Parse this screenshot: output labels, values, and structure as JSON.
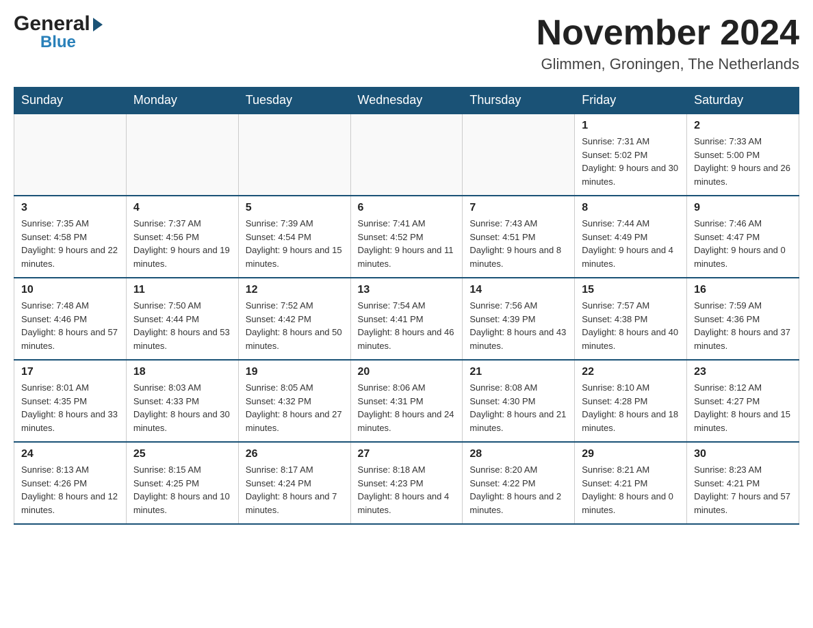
{
  "logo": {
    "line1": "General",
    "line2": "Blue"
  },
  "title": "November 2024",
  "location": "Glimmen, Groningen, The Netherlands",
  "days_of_week": [
    "Sunday",
    "Monday",
    "Tuesday",
    "Wednesday",
    "Thursday",
    "Friday",
    "Saturday"
  ],
  "weeks": [
    [
      {
        "day": "",
        "info": ""
      },
      {
        "day": "",
        "info": ""
      },
      {
        "day": "",
        "info": ""
      },
      {
        "day": "",
        "info": ""
      },
      {
        "day": "",
        "info": ""
      },
      {
        "day": "1",
        "info": "Sunrise: 7:31 AM\nSunset: 5:02 PM\nDaylight: 9 hours and 30 minutes."
      },
      {
        "day": "2",
        "info": "Sunrise: 7:33 AM\nSunset: 5:00 PM\nDaylight: 9 hours and 26 minutes."
      }
    ],
    [
      {
        "day": "3",
        "info": "Sunrise: 7:35 AM\nSunset: 4:58 PM\nDaylight: 9 hours and 22 minutes."
      },
      {
        "day": "4",
        "info": "Sunrise: 7:37 AM\nSunset: 4:56 PM\nDaylight: 9 hours and 19 minutes."
      },
      {
        "day": "5",
        "info": "Sunrise: 7:39 AM\nSunset: 4:54 PM\nDaylight: 9 hours and 15 minutes."
      },
      {
        "day": "6",
        "info": "Sunrise: 7:41 AM\nSunset: 4:52 PM\nDaylight: 9 hours and 11 minutes."
      },
      {
        "day": "7",
        "info": "Sunrise: 7:43 AM\nSunset: 4:51 PM\nDaylight: 9 hours and 8 minutes."
      },
      {
        "day": "8",
        "info": "Sunrise: 7:44 AM\nSunset: 4:49 PM\nDaylight: 9 hours and 4 minutes."
      },
      {
        "day": "9",
        "info": "Sunrise: 7:46 AM\nSunset: 4:47 PM\nDaylight: 9 hours and 0 minutes."
      }
    ],
    [
      {
        "day": "10",
        "info": "Sunrise: 7:48 AM\nSunset: 4:46 PM\nDaylight: 8 hours and 57 minutes."
      },
      {
        "day": "11",
        "info": "Sunrise: 7:50 AM\nSunset: 4:44 PM\nDaylight: 8 hours and 53 minutes."
      },
      {
        "day": "12",
        "info": "Sunrise: 7:52 AM\nSunset: 4:42 PM\nDaylight: 8 hours and 50 minutes."
      },
      {
        "day": "13",
        "info": "Sunrise: 7:54 AM\nSunset: 4:41 PM\nDaylight: 8 hours and 46 minutes."
      },
      {
        "day": "14",
        "info": "Sunrise: 7:56 AM\nSunset: 4:39 PM\nDaylight: 8 hours and 43 minutes."
      },
      {
        "day": "15",
        "info": "Sunrise: 7:57 AM\nSunset: 4:38 PM\nDaylight: 8 hours and 40 minutes."
      },
      {
        "day": "16",
        "info": "Sunrise: 7:59 AM\nSunset: 4:36 PM\nDaylight: 8 hours and 37 minutes."
      }
    ],
    [
      {
        "day": "17",
        "info": "Sunrise: 8:01 AM\nSunset: 4:35 PM\nDaylight: 8 hours and 33 minutes."
      },
      {
        "day": "18",
        "info": "Sunrise: 8:03 AM\nSunset: 4:33 PM\nDaylight: 8 hours and 30 minutes."
      },
      {
        "day": "19",
        "info": "Sunrise: 8:05 AM\nSunset: 4:32 PM\nDaylight: 8 hours and 27 minutes."
      },
      {
        "day": "20",
        "info": "Sunrise: 8:06 AM\nSunset: 4:31 PM\nDaylight: 8 hours and 24 minutes."
      },
      {
        "day": "21",
        "info": "Sunrise: 8:08 AM\nSunset: 4:30 PM\nDaylight: 8 hours and 21 minutes."
      },
      {
        "day": "22",
        "info": "Sunrise: 8:10 AM\nSunset: 4:28 PM\nDaylight: 8 hours and 18 minutes."
      },
      {
        "day": "23",
        "info": "Sunrise: 8:12 AM\nSunset: 4:27 PM\nDaylight: 8 hours and 15 minutes."
      }
    ],
    [
      {
        "day": "24",
        "info": "Sunrise: 8:13 AM\nSunset: 4:26 PM\nDaylight: 8 hours and 12 minutes."
      },
      {
        "day": "25",
        "info": "Sunrise: 8:15 AM\nSunset: 4:25 PM\nDaylight: 8 hours and 10 minutes."
      },
      {
        "day": "26",
        "info": "Sunrise: 8:17 AM\nSunset: 4:24 PM\nDaylight: 8 hours and 7 minutes."
      },
      {
        "day": "27",
        "info": "Sunrise: 8:18 AM\nSunset: 4:23 PM\nDaylight: 8 hours and 4 minutes."
      },
      {
        "day": "28",
        "info": "Sunrise: 8:20 AM\nSunset: 4:22 PM\nDaylight: 8 hours and 2 minutes."
      },
      {
        "day": "29",
        "info": "Sunrise: 8:21 AM\nSunset: 4:21 PM\nDaylight: 8 hours and 0 minutes."
      },
      {
        "day": "30",
        "info": "Sunrise: 8:23 AM\nSunset: 4:21 PM\nDaylight: 7 hours and 57 minutes."
      }
    ]
  ]
}
